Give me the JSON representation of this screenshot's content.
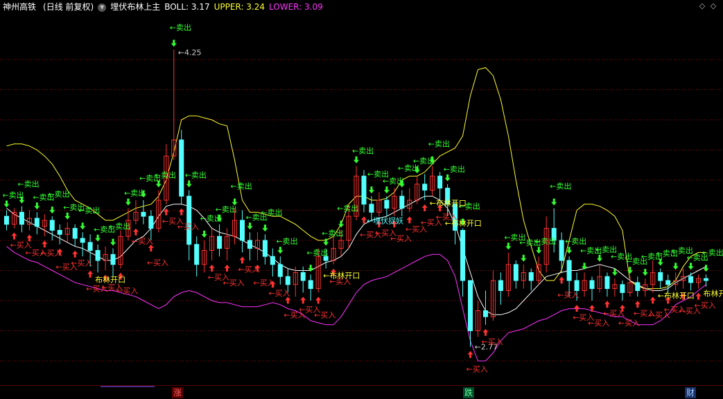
{
  "header": {
    "stock_name": "神州高铁",
    "period": "(日线 前复权)",
    "indicator": "埋伏布林上主",
    "boll_label": "BOLL: 3.17",
    "upper_label": "UPPER: 3.24",
    "lower_label": "LOWER: 3.09",
    "nav_prev": "◇",
    "nav_next": "◇"
  },
  "footer": {
    "event_zhang": "涨",
    "event_die": "跌",
    "event_cai": "财"
  },
  "colors": {
    "background": "#000000",
    "up_candle": "#ff3232",
    "down_candle": "#54ffff",
    "upper_band": "#ffff33",
    "mid_band": "#ffffff",
    "lower_band": "#ff33ff",
    "buy_signal": "#ff3333",
    "sell_signal": "#33ff33",
    "band_signal": "#ffff33",
    "ambush_signal": "#54ffff",
    "grid": "#b00000"
  },
  "chart_data": {
    "type": "candlestick",
    "title": "埋伏布林上主",
    "ylim": [
      2.6,
      4.4
    ],
    "grid": true,
    "price_annotations": {
      "high": "4.25",
      "low": "2.77"
    },
    "signal_texts": {
      "buy": "←买入",
      "sell": "←卖出",
      "band_open": "布林开口",
      "ambush": "←埋伏捉妖"
    },
    "band_open_labels": [
      "布林开口",
      "←布林开口",
      "←布林开口",
      "←布林开口",
      "←布林开口",
      "布林开口",
      "←布"
    ],
    "ambush_labels": [
      "←埋伏捉妖"
    ],
    "upper": [
      3.77,
      3.78,
      3.78,
      3.77,
      3.75,
      3.72,
      3.68,
      3.62,
      3.55,
      3.5,
      3.48,
      3.46,
      3.43,
      3.4,
      3.4,
      3.42,
      3.44,
      3.46,
      3.47,
      3.48,
      3.52,
      3.6,
      3.74,
      3.9,
      3.92,
      3.92,
      3.91,
      3.9,
      3.88,
      3.87,
      3.7,
      3.5,
      3.44,
      3.44,
      3.43,
      3.42,
      3.42,
      3.4,
      3.38,
      3.35,
      3.32,
      3.3,
      3.3,
      3.32,
      3.38,
      3.48,
      3.52,
      3.52,
      3.5,
      3.5,
      3.51,
      3.54,
      3.6,
      3.62,
      3.62,
      3.64,
      3.68,
      3.72,
      3.74,
      3.76,
      3.82,
      4.02,
      4.15,
      4.16,
      4.12,
      4.0,
      3.82,
      3.6,
      3.4,
      3.27,
      3.15,
      3.1,
      3.1,
      3.15,
      3.3,
      3.45,
      3.48,
      3.48,
      3.47,
      3.45,
      3.42,
      3.35,
      3.1,
      3.07,
      3.06,
      3.06,
      3.06,
      3.07,
      3.1,
      3.17,
      3.22,
      3.24,
      3.24
    ],
    "mid": [
      3.46,
      3.43,
      3.41,
      3.39,
      3.37,
      3.35,
      3.33,
      3.31,
      3.29,
      3.27,
      3.26,
      3.24,
      3.22,
      3.2,
      3.2,
      3.22,
      3.26,
      3.3,
      3.32,
      3.36,
      3.42,
      3.47,
      3.48,
      3.48,
      3.47,
      3.45,
      3.41,
      3.36,
      3.34,
      3.33,
      3.32,
      3.3,
      3.28,
      3.26,
      3.24,
      3.21,
      3.18,
      3.16,
      3.15,
      3.15,
      3.15,
      3.17,
      3.19,
      3.2,
      3.22,
      3.26,
      3.33,
      3.38,
      3.4,
      3.41,
      3.42,
      3.44,
      3.46,
      3.48,
      3.5,
      3.52,
      3.52,
      3.5,
      3.46,
      3.38,
      3.26,
      3.14,
      3.02,
      2.95,
      2.93,
      2.93,
      2.94,
      2.96,
      3.0,
      3.04,
      3.08,
      3.12,
      3.13,
      3.14,
      3.15,
      3.15,
      3.16,
      3.17,
      3.18,
      3.17,
      3.16,
      3.13,
      3.1,
      3.08,
      3.06,
      3.05,
      3.05,
      3.06,
      3.09,
      3.11,
      3.13,
      3.15,
      3.17
    ],
    "lower": [
      3.27,
      3.24,
      3.22,
      3.2,
      3.19,
      3.17,
      3.15,
      3.13,
      3.11,
      3.09,
      3.08,
      3.07,
      3.06,
      3.05,
      3.05,
      3.04,
      3.03,
      3.02,
      3.0,
      2.98,
      2.96,
      2.98,
      3.02,
      3.04,
      3.05,
      3.04,
      3.02,
      3.0,
      2.99,
      2.99,
      2.98,
      2.97,
      2.97,
      2.97,
      2.98,
      2.99,
      2.98,
      2.96,
      2.95,
      2.93,
      2.9,
      2.89,
      2.88,
      2.88,
      2.92,
      2.98,
      3.04,
      3.08,
      3.1,
      3.11,
      3.12,
      3.14,
      3.16,
      3.18,
      3.2,
      3.22,
      3.23,
      3.23,
      3.2,
      3.12,
      2.96,
      2.8,
      2.7,
      2.7,
      2.74,
      2.8,
      2.84,
      2.85,
      2.86,
      2.88,
      2.9,
      2.91,
      2.93,
      2.95,
      2.96,
      2.96,
      2.96,
      2.95,
      2.94,
      2.93,
      2.92,
      2.92,
      2.9,
      2.88,
      2.88,
      2.88,
      2.9,
      2.93,
      2.98,
      3.0,
      3.02,
      3.05,
      3.08
    ],
    "candles": [
      {
        "o": 3.42,
        "c": 3.38,
        "h": 3.45,
        "l": 3.35
      },
      {
        "o": 3.38,
        "c": 3.44,
        "h": 3.46,
        "l": 3.36
      },
      {
        "o": 3.44,
        "c": 3.38,
        "h": 3.47,
        "l": 3.34
      },
      {
        "o": 3.38,
        "c": 3.41,
        "h": 3.45,
        "l": 3.35
      },
      {
        "o": 3.41,
        "c": 3.37,
        "h": 3.44,
        "l": 3.33
      },
      {
        "o": 3.37,
        "c": 3.4,
        "h": 3.43,
        "l": 3.32
      },
      {
        "o": 3.4,
        "c": 3.35,
        "h": 3.42,
        "l": 3.3
      },
      {
        "o": 3.35,
        "c": 3.33,
        "h": 3.38,
        "l": 3.28
      },
      {
        "o": 3.33,
        "c": 3.36,
        "h": 3.39,
        "l": 3.29
      },
      {
        "o": 3.36,
        "c": 3.31,
        "h": 3.38,
        "l": 3.27
      },
      {
        "o": 3.31,
        "c": 3.29,
        "h": 3.34,
        "l": 3.22
      },
      {
        "o": 3.29,
        "c": 3.25,
        "h": 3.33,
        "l": 3.17
      },
      {
        "o": 3.25,
        "c": 3.2,
        "h": 3.28,
        "l": 3.14
      },
      {
        "o": 3.2,
        "c": 3.23,
        "h": 3.27,
        "l": 3.15
      },
      {
        "o": 3.23,
        "c": 3.18,
        "h": 3.26,
        "l": 3.12
      },
      {
        "o": 3.18,
        "c": 3.32,
        "h": 3.35,
        "l": 3.16
      },
      {
        "o": 3.32,
        "c": 3.4,
        "h": 3.46,
        "l": 3.3
      },
      {
        "o": 3.4,
        "c": 3.44,
        "h": 3.5,
        "l": 3.38
      },
      {
        "o": 3.44,
        "c": 3.42,
        "h": 3.5,
        "l": 3.38
      },
      {
        "o": 3.42,
        "c": 3.36,
        "h": 3.45,
        "l": 3.3
      },
      {
        "o": 3.36,
        "c": 3.5,
        "h": 3.55,
        "l": 3.34
      },
      {
        "o": 3.5,
        "c": 3.72,
        "h": 3.78,
        "l": 3.48
      },
      {
        "o": 3.72,
        "c": 3.8,
        "h": 4.25,
        "l": 3.7
      },
      {
        "o": 3.8,
        "c": 3.52,
        "h": 3.85,
        "l": 3.48
      },
      {
        "o": 3.52,
        "c": 3.28,
        "h": 3.55,
        "l": 3.2
      },
      {
        "o": 3.28,
        "c": 3.18,
        "h": 3.32,
        "l": 3.12
      },
      {
        "o": 3.18,
        "c": 3.25,
        "h": 3.3,
        "l": 3.14
      },
      {
        "o": 3.25,
        "c": 3.32,
        "h": 3.36,
        "l": 3.2
      },
      {
        "o": 3.32,
        "c": 3.26,
        "h": 3.38,
        "l": 3.22
      },
      {
        "o": 3.26,
        "c": 3.32,
        "h": 3.36,
        "l": 3.2
      },
      {
        "o": 3.32,
        "c": 3.4,
        "h": 3.46,
        "l": 3.28
      },
      {
        "o": 3.4,
        "c": 3.3,
        "h": 3.45,
        "l": 3.24
      },
      {
        "o": 3.3,
        "c": 3.26,
        "h": 3.34,
        "l": 3.2
      },
      {
        "o": 3.26,
        "c": 3.3,
        "h": 3.34,
        "l": 3.2
      },
      {
        "o": 3.3,
        "c": 3.22,
        "h": 3.33,
        "l": 3.18
      },
      {
        "o": 3.22,
        "c": 3.18,
        "h": 3.26,
        "l": 3.12
      },
      {
        "o": 3.18,
        "c": 3.12,
        "h": 3.22,
        "l": 3.08
      },
      {
        "o": 3.12,
        "c": 3.08,
        "h": 3.16,
        "l": 3.04
      },
      {
        "o": 3.08,
        "c": 3.14,
        "h": 3.17,
        "l": 3.02
      },
      {
        "o": 3.14,
        "c": 3.1,
        "h": 3.17,
        "l": 3.04
      },
      {
        "o": 3.1,
        "c": 3.06,
        "h": 3.13,
        "l": 3.0
      },
      {
        "o": 3.06,
        "c": 3.22,
        "h": 3.26,
        "l": 3.04
      },
      {
        "o": 3.22,
        "c": 3.2,
        "h": 3.26,
        "l": 3.16
      },
      {
        "o": 3.2,
        "c": 3.26,
        "h": 3.32,
        "l": 3.18
      },
      {
        "o": 3.26,
        "c": 3.3,
        "h": 3.35,
        "l": 3.22
      },
      {
        "o": 3.3,
        "c": 3.42,
        "h": 3.48,
        "l": 3.26
      },
      {
        "o": 3.42,
        "c": 3.62,
        "h": 3.67,
        "l": 3.4
      },
      {
        "o": 3.62,
        "c": 3.48,
        "h": 3.65,
        "l": 3.44
      },
      {
        "o": 3.48,
        "c": 3.44,
        "h": 3.52,
        "l": 3.4
      },
      {
        "o": 3.44,
        "c": 3.5,
        "h": 3.54,
        "l": 3.42
      },
      {
        "o": 3.5,
        "c": 3.46,
        "h": 3.52,
        "l": 3.42
      },
      {
        "o": 3.46,
        "c": 3.52,
        "h": 3.56,
        "l": 3.42
      },
      {
        "o": 3.52,
        "c": 3.46,
        "h": 3.55,
        "l": 3.42
      },
      {
        "o": 3.46,
        "c": 3.5,
        "h": 3.56,
        "l": 3.44
      },
      {
        "o": 3.5,
        "c": 3.58,
        "h": 3.62,
        "l": 3.48
      },
      {
        "o": 3.58,
        "c": 3.55,
        "h": 3.63,
        "l": 3.5
      },
      {
        "o": 3.55,
        "c": 3.62,
        "h": 3.67,
        "l": 3.52
      },
      {
        "o": 3.62,
        "c": 3.56,
        "h": 3.64,
        "l": 3.5
      },
      {
        "o": 3.56,
        "c": 3.48,
        "h": 3.58,
        "l": 3.42
      },
      {
        "o": 3.48,
        "c": 3.35,
        "h": 3.5,
        "l": 3.28
      },
      {
        "o": 3.35,
        "c": 3.1,
        "h": 3.36,
        "l": 3.02
      },
      {
        "o": 3.1,
        "c": 2.85,
        "h": 3.06,
        "l": 2.77
      },
      {
        "o": 2.85,
        "c": 2.95,
        "h": 3.0,
        "l": 2.82
      },
      {
        "o": 2.95,
        "c": 2.92,
        "h": 3.05,
        "l": 2.88
      },
      {
        "o": 2.92,
        "c": 3.1,
        "h": 3.15,
        "l": 2.9
      },
      {
        "o": 3.1,
        "c": 3.05,
        "h": 3.14,
        "l": 2.98
      },
      {
        "o": 3.05,
        "c": 3.18,
        "h": 3.24,
        "l": 3.02
      },
      {
        "o": 3.18,
        "c": 3.1,
        "h": 3.2,
        "l": 3.06
      },
      {
        "o": 3.1,
        "c": 3.14,
        "h": 3.18,
        "l": 3.06
      },
      {
        "o": 3.14,
        "c": 3.1,
        "h": 3.16,
        "l": 3.05
      },
      {
        "o": 3.1,
        "c": 3.18,
        "h": 3.22,
        "l": 3.08
      },
      {
        "o": 3.18,
        "c": 3.36,
        "h": 3.42,
        "l": 3.14
      },
      {
        "o": 3.36,
        "c": 3.3,
        "h": 3.46,
        "l": 3.24
      },
      {
        "o": 3.3,
        "c": 3.2,
        "h": 3.34,
        "l": 3.14
      },
      {
        "o": 3.2,
        "c": 3.1,
        "h": 3.22,
        "l": 3.02
      },
      {
        "o": 3.1,
        "c": 3.05,
        "h": 3.14,
        "l": 3.0
      },
      {
        "o": 3.05,
        "c": 3.1,
        "h": 3.14,
        "l": 3.02
      },
      {
        "o": 3.1,
        "c": 3.06,
        "h": 3.12,
        "l": 3.0
      },
      {
        "o": 3.06,
        "c": 3.12,
        "h": 3.18,
        "l": 3.04
      },
      {
        "o": 3.12,
        "c": 3.06,
        "h": 3.14,
        "l": 3.02
      },
      {
        "o": 3.06,
        "c": 3.08,
        "h": 3.11,
        "l": 3.02
      },
      {
        "o": 3.08,
        "c": 3.04,
        "h": 3.1,
        "l": 3.0
      },
      {
        "o": 3.04,
        "c": 3.09,
        "h": 3.12,
        "l": 3.02
      },
      {
        "o": 3.09,
        "c": 3.05,
        "h": 3.12,
        "l": 3.02
      },
      {
        "o": 3.05,
        "c": 3.08,
        "h": 3.11,
        "l": 3.02
      },
      {
        "o": 3.08,
        "c": 3.14,
        "h": 3.2,
        "l": 3.04
      },
      {
        "o": 3.14,
        "c": 3.1,
        "h": 3.16,
        "l": 3.06
      },
      {
        "o": 3.1,
        "c": 3.08,
        "h": 3.13,
        "l": 3.04
      },
      {
        "o": 3.08,
        "c": 3.1,
        "h": 3.14,
        "l": 3.05
      },
      {
        "o": 3.1,
        "c": 3.12,
        "h": 3.16,
        "l": 3.06
      },
      {
        "o": 3.12,
        "c": 3.09,
        "h": 3.14,
        "l": 3.05
      },
      {
        "o": 3.09,
        "c": 3.11,
        "h": 3.13,
        "l": 3.06
      },
      {
        "o": 3.11,
        "c": 3.1,
        "h": 3.13,
        "l": 3.07
      }
    ],
    "buy_signals": [
      1,
      3,
      5,
      7,
      9,
      11,
      13,
      15,
      17,
      19,
      21,
      23,
      27,
      29,
      31,
      33,
      35,
      37,
      39,
      41,
      43,
      47,
      49,
      51,
      53,
      55,
      57,
      61,
      63,
      73,
      75,
      77,
      79,
      81,
      83,
      85,
      87,
      89,
      91
    ],
    "sell_signals": [
      0,
      2,
      4,
      6,
      8,
      10,
      12,
      14,
      16,
      18,
      20,
      22,
      24,
      26,
      28,
      30,
      32,
      34,
      36,
      40,
      42,
      44,
      46,
      48,
      50,
      52,
      54,
      56,
      58,
      60,
      66,
      68,
      70,
      72,
      74,
      76,
      78,
      80,
      82,
      84,
      86,
      88,
      90,
      92
    ],
    "band_open_signals": [
      12,
      42,
      56,
      58,
      86,
      92
    ],
    "ambush_signals": [
      47
    ]
  }
}
